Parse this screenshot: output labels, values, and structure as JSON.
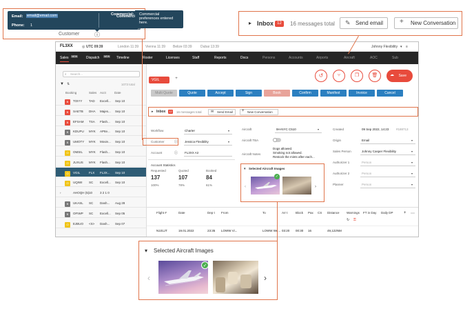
{
  "tooltip": {
    "email_label": "Email:",
    "email_value": "email@email.com",
    "phone_label": "Phone:",
    "phone_value": "1",
    "commercial_label": "Commercial:",
    "commercial_value": "Commercial preferences entered here.",
    "customer_label": "Customer",
    "info_icon": "info-circle-icon",
    "partial_text": "Airc"
  },
  "inbox_callout": {
    "label": "Inbox",
    "count": "12",
    "summary": "16 messages total",
    "send_email": "Send email",
    "new_conversation": "New Conversation"
  },
  "images_callout": {
    "title": "Selected Aircraft Images"
  },
  "app": {
    "logo": "FL3XX",
    "time_utc": "UTC 09:39",
    "clocks": [
      "London 11:39",
      "Vienna 11:39",
      "Belize 03:39",
      "Dubai 13:39"
    ],
    "user": "Johnny Flexibility",
    "nav": [
      {
        "label": "Sales",
        "badge": "NEW",
        "active": true
      },
      {
        "label": "Dispatch",
        "badge": "NEW"
      },
      {
        "label": "Timeline"
      },
      {
        "label": "Roster"
      },
      {
        "label": "Licenses"
      },
      {
        "label": "Staff"
      },
      {
        "label": "Reports"
      },
      {
        "label": "Docs"
      },
      {
        "label": "Persons",
        "dim": true
      },
      {
        "label": "Accounts",
        "dim": true
      },
      {
        "label": "Airports",
        "dim": true
      },
      {
        "label": "Aircraft",
        "dim": true
      },
      {
        "label": "AOC",
        "dim": true
      },
      {
        "label": "Sub",
        "dim": true
      }
    ],
    "sidebar": {
      "search_placeholder": "Search...",
      "total": "1073 total",
      "columns": [
        "Booking",
        "Sales",
        "Acct",
        "Date"
      ],
      "rows": [
        {
          "id": "TOIYY",
          "sales": "TAD",
          "acct": "Excell...",
          "date": "Sep 10",
          "color": "#e84b3c",
          "letter": "B"
        },
        {
          "id": "SAETB",
          "sales": "DHA",
          "acct": "Majes...",
          "date": "Sep 10",
          "color": "#e84b3c",
          "letter": "B"
        },
        {
          "id": "EFSAM",
          "sales": "TSA",
          "acct": "Flash...",
          "date": "Sep 10",
          "color": "#e84b3c",
          "letter": "B"
        },
        {
          "id": "KDUPU",
          "sales": "MYK",
          "acct": "APIte...",
          "date": "Sep 10",
          "color": "#777777",
          "letter": "B"
        },
        {
          "id": "UMOTY",
          "sales": "MYK",
          "acct": "Movie...",
          "date": "Sep 10",
          "color": "#777777",
          "letter": "B"
        },
        {
          "id": "OMSIL",
          "sales": "MYK",
          "acct": "Flash...",
          "date": "Sep 10",
          "color": "#f0c419",
          "letter": "O"
        },
        {
          "id": "JUXUS",
          "sales": "MYK",
          "acct": "Flash...",
          "date": "Sep 10",
          "color": "#f0c419",
          "letter": "O"
        },
        {
          "id": "VGIL",
          "sales": "FLX",
          "acct": "FL3X...",
          "date": "Sep 10",
          "color": "#f0c419",
          "letter": "O",
          "selected": true
        },
        {
          "id": "UQIWI",
          "sales": "SC",
          "acct": "Excell...",
          "date": "Sep 10",
          "color": "#f0c419",
          "letter": "O"
        },
        {
          "id": "AHOQH (5)",
          "sales": "10",
          "acct": "3 2 1 0",
          "date": "",
          "color": "",
          "letter": ""
        },
        {
          "id": "UKASL",
          "sales": "SC",
          "acct": "Dash...",
          "date": "Aug 28",
          "color": "#777777",
          "letter": "B"
        },
        {
          "id": "OFIWP",
          "sales": "SC",
          "acct": "Excell...",
          "date": "Sep 05",
          "color": "#777777",
          "letter": "B"
        },
        {
          "id": "EJBUO",
          "sales": "<S>",
          "acct": "Dash...",
          "date": "Sep 07",
          "color": "#f0c419",
          "letter": "O"
        }
      ]
    },
    "main": {
      "tab": "VGIL",
      "tab_add": "+",
      "actions": [
        "Multi Quote",
        "Quote",
        "Accept",
        "Sign",
        "Book",
        "Confirm",
        "Manifest",
        "Invoice",
        "Cancel"
      ],
      "save": "Save",
      "inbox": {
        "label": "Inbox",
        "count": "12",
        "summary": "16 messages total",
        "send": "Send Email",
        "new": "New Conversation"
      },
      "fields_left": [
        {
          "label": "Workflow",
          "value": "Charter"
        },
        {
          "label": "Customer",
          "value": "Jessica Flexibility"
        },
        {
          "label": "Account",
          "value": "FL3XX Air"
        }
      ],
      "stats_title": "Account Statistics",
      "stats_headers": [
        "Requested",
        "Quoted",
        "Booked"
      ],
      "stats_values": [
        "137",
        "107",
        "84"
      ],
      "stats_pct": [
        "100%",
        "78%",
        "61%"
      ],
      "fields_mid": [
        {
          "label": "Aircraft",
          "value": "9H-NYC C510"
        },
        {
          "label": "Aircraft TBA",
          "value": ""
        },
        {
          "label": "Aircraft Notes",
          "value": "Dogs allowed.\nSmoking not allowed.\nRestock the mints after each..."
        }
      ],
      "images_label": "Selected Aircraft Images",
      "fields_right": [
        {
          "label": "Created",
          "value": "09 Sep 2022, 14:23",
          "extra": "#188713"
        },
        {
          "label": "Origin",
          "value": "Email"
        },
        {
          "label": "Sales Person",
          "value": "Johnny Casper Flexibility"
        },
        {
          "label": "Authorizer 1",
          "value": "Person"
        },
        {
          "label": "Authorizer 2",
          "value": "Person"
        },
        {
          "label": "Planner",
          "value": "Person"
        }
      ],
      "flight_headers": [
        "Flight #",
        "Date",
        "Dep t",
        "From",
        "To",
        "Arr t",
        "Block",
        "Pax",
        "CS",
        "Distance",
        "Warnings",
        "FT in Day",
        "Daily DP"
      ],
      "flight_row": [
        "N101JT",
        "19.01.2022",
        "23:35",
        "LOWW Vi...",
        "LOWW We...",
        "03:20",
        "00:30",
        "16",
        "",
        "49,122NM",
        "",
        "",
        ""
      ]
    }
  }
}
